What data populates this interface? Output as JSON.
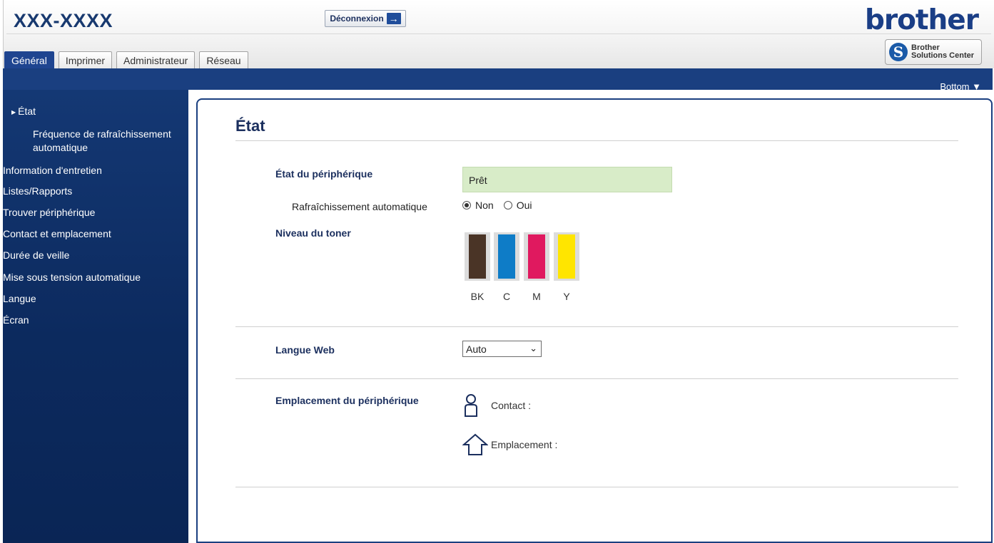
{
  "header": {
    "model": "XXX-XXXX",
    "logout_label": "Déconnexion",
    "brand": "brother",
    "solutions_center_line1": "Brother",
    "solutions_center_line2": "Solutions Center"
  },
  "tabs": [
    {
      "label": "Général",
      "active": true
    },
    {
      "label": "Imprimer",
      "active": false
    },
    {
      "label": "Administrateur",
      "active": false
    },
    {
      "label": "Réseau",
      "active": false
    }
  ],
  "bottom_link": "Bottom ▼",
  "sidebar": {
    "items": [
      {
        "label": "État"
      },
      {
        "label": "Fréquence de rafraîchissement"
      },
      {
        "label": "automatique"
      },
      {
        "label": "Information d'entretien"
      },
      {
        "label": "Listes/Rapports"
      },
      {
        "label": "Trouver périphérique"
      },
      {
        "label": "Contact et emplacement"
      },
      {
        "label": "Durée de veille"
      },
      {
        "label": "Mise sous tension automatique"
      },
      {
        "label": "Langue"
      },
      {
        "label": "Écran"
      }
    ]
  },
  "main": {
    "title": "État",
    "device_status_label": "État du périphérique",
    "device_status_value": "Prêt",
    "auto_refresh_label": "Rafraîchissement automatique",
    "auto_refresh_options": [
      {
        "label": "Non",
        "checked": true
      },
      {
        "label": "Oui",
        "checked": false
      }
    ],
    "toner_label": "Niveau du toner",
    "toners": [
      {
        "name": "BK",
        "color": "#4a3426",
        "level": 1.0
      },
      {
        "name": "C",
        "color": "#0e7cc7",
        "level": 1.0
      },
      {
        "name": "M",
        "color": "#e0195f",
        "level": 1.0
      },
      {
        "name": "Y",
        "color": "#ffe500",
        "level": 1.0
      }
    ],
    "web_language_label": "Langue Web",
    "web_language_value": "Auto",
    "location_label": "Emplacement du périphérique",
    "contact_label": "Contact :",
    "location_value_label": "Emplacement :"
  },
  "colors": {
    "navy": "#1a3f80",
    "sidebar": "#0c2a5e",
    "status_bg": "#d8ecc8"
  }
}
